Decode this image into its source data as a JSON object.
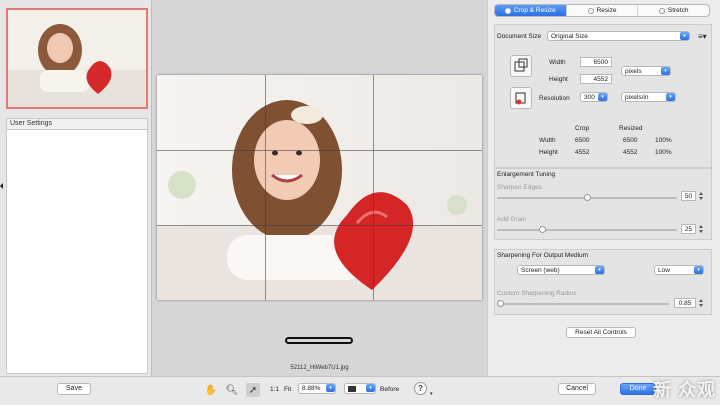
{
  "left": {
    "user_settings_title": "User Settings"
  },
  "center": {
    "filename": "52112_HiWeb7U1.jpg"
  },
  "tabs": [
    {
      "label": "Crop & Resize",
      "active": true
    },
    {
      "label": "Resize",
      "active": false
    },
    {
      "label": "Stretch",
      "active": false
    }
  ],
  "document": {
    "size_label": "Document Size",
    "size_value": "Original Size",
    "width_label": "Width",
    "width_value": "6500",
    "height_label": "Height",
    "height_value": "4552",
    "units_value": "pixels",
    "resolution_label": "Resolution",
    "resolution_value": "300",
    "resolution_units": "pixels/in"
  },
  "crop_table": {
    "col_crop": "Crop",
    "col_resized": "Resized",
    "rows": [
      {
        "label": "Width",
        "crop": "6500",
        "resized": "6500",
        "pct": "100%"
      },
      {
        "label": "Height",
        "crop": "4552",
        "resized": "4552",
        "pct": "100%"
      }
    ]
  },
  "enlargement": {
    "title": "Enlargement Tuning",
    "sharpen_label": "Sharpen Edges",
    "sharpen_value": "50",
    "sharpen_fraction": 0.5,
    "grain_label": "Add Grain",
    "grain_value": "25",
    "grain_fraction": 0.25
  },
  "output": {
    "title": "Sharpening For Output Medium",
    "medium_value": "Screen (web)",
    "level_value": "Low",
    "radius_label": "Custom Sharpening Radius",
    "radius_value": "0.85",
    "radius_fraction": 0.0
  },
  "reset_label": "Reset All Controls",
  "bottom": {
    "save_label": "Save",
    "zoom_1to1": "1:1",
    "fit_label": "Fit",
    "zoom_value": "8.88%",
    "before_label": "Before",
    "help_label": "?",
    "cancel_label": "Cancel",
    "done_label": "Done"
  },
  "watermark": "新 众观",
  "colors": {
    "accent": "#2c6fe3",
    "thumb_border": "#e57777"
  }
}
